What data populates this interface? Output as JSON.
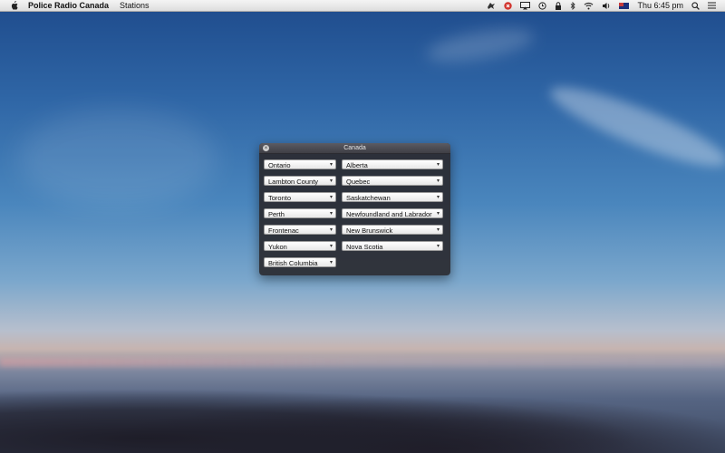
{
  "menubar": {
    "app_name": "Police Radio Canada",
    "menus": [
      "Stations"
    ],
    "clock": "Thu 6:45 pm"
  },
  "window": {
    "title": "Canada",
    "left_column": [
      "Ontario",
      "Lambton County",
      "Toronto",
      "Perth",
      "Frontenac",
      "Yukon",
      "British Columbia"
    ],
    "right_column": [
      "Alberta",
      "Quebec",
      "Saskatchewan",
      "Newfoundland and Labrador",
      "New Brunswick",
      "Nova Scotia"
    ]
  },
  "icons": {
    "menubar_status": [
      "bird-icon",
      "close-circle-icon",
      "airplay-icon",
      "time-machine-icon",
      "lock-icon",
      "bluetooth-icon",
      "wifi-icon",
      "volume-icon",
      "flag-icon",
      "search-icon",
      "list-icon"
    ],
    "arrow": "▾"
  },
  "colors": {
    "window_bg": "#2a2a30",
    "select_bg": "#ffffff",
    "menubar_bg": "#eaeaea"
  }
}
